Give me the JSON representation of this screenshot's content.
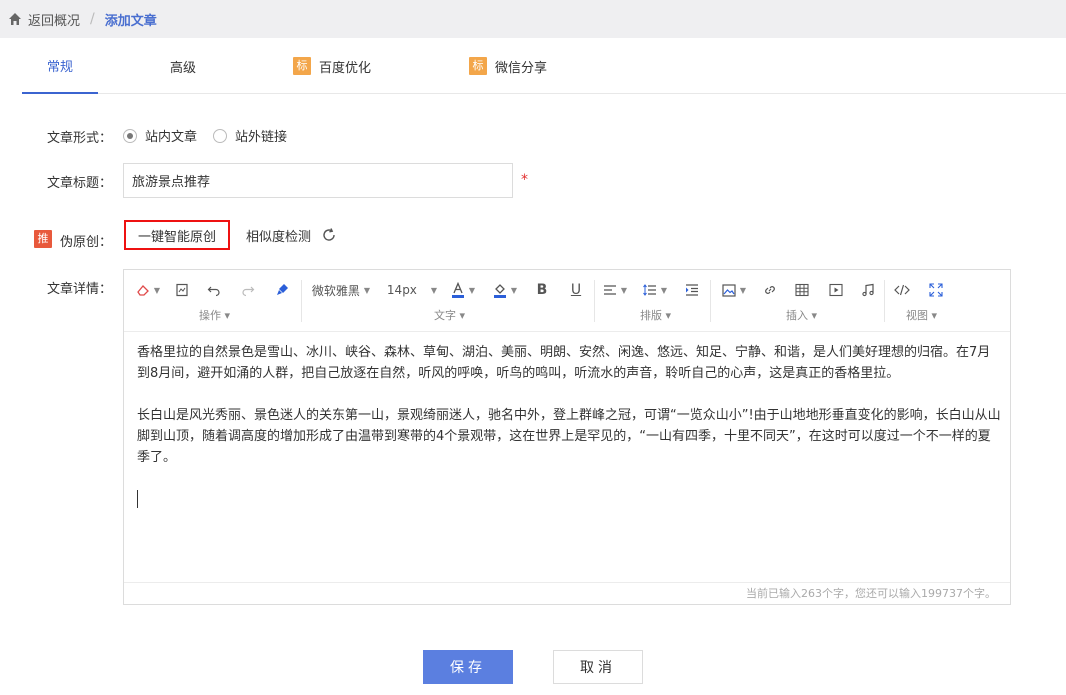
{
  "breadcrumb": {
    "home_icon": "home-icon",
    "back_label": "返回概况",
    "separator": "/",
    "current": "添加文章"
  },
  "tabs": [
    {
      "label": "常规",
      "badge": ""
    },
    {
      "label": "高级",
      "badge": ""
    },
    {
      "label": "百度优化",
      "badge": "标"
    },
    {
      "label": "微信分享",
      "badge": "标"
    }
  ],
  "form": {
    "type_label": "文章形式：",
    "type_options": [
      {
        "label": "站内文章",
        "checked": true
      },
      {
        "label": "站外链接",
        "checked": false
      }
    ],
    "title_label": "文章标题：",
    "title_value": "旅游景点推荐",
    "required_mark": "*",
    "pseudo_badge": "推",
    "pseudo_label": "伪原创：",
    "ai_button": "一键智能原创",
    "similarity_button": "相似度检测",
    "detail_label": "文章详情："
  },
  "toolbar": {
    "font_family": "微软雅黑",
    "font_size": "14px",
    "text_color": "#2b5fd9",
    "highlight_color": "#2b5fd9",
    "groups": [
      "操作",
      "文字",
      "排版",
      "插入",
      "视图"
    ]
  },
  "editor": {
    "paragraphs": [
      "香格里拉的自然景色是雪山、冰川、峡谷、森林、草甸、湖泊、美丽、明朗、安然、闲逸、悠远、知足、宁静、和谐，是人们美好理想的归宿。在7月到8月间，避开如涌的人群，把自己放逐在自然，听风的呼唤，听鸟的鸣叫，听流水的声音，聆听自己的心声，这是真正的香格里拉。",
      "长白山是风光秀丽、景色迷人的关东第一山，景观绮丽迷人，驰名中外，登上群峰之冠，可谓“一览众山小”!由于山地地形垂直变化的影响，长白山从山脚到山顶，随着调高度的增加形成了由温带到寒带的4个景观带，这在世界上是罕见的，“一山有四季，十里不同天”，在这时可以度过一个不一样的夏季了。"
    ],
    "counter": "当前已输入263个字，您还可以输入199737个字。"
  },
  "actions": {
    "save": "保存",
    "cancel": "取消"
  }
}
